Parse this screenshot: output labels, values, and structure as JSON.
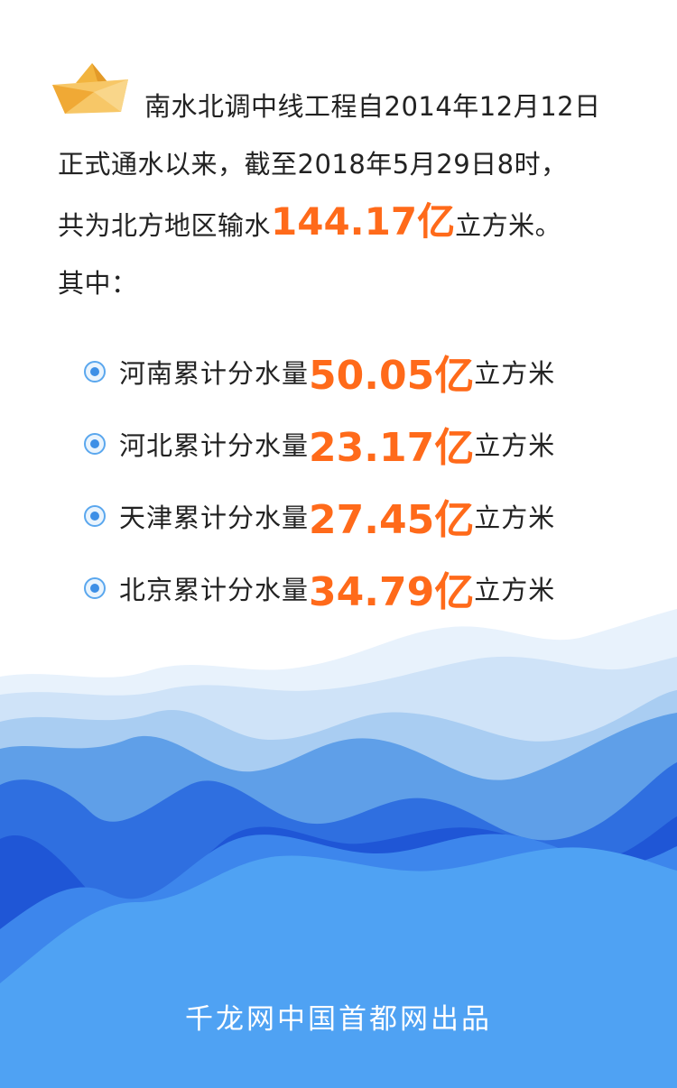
{
  "intro": {
    "line1": "南水北调中线工程自2014年12月12日",
    "line2": "正式通水以来，截至2018年5月29日8时，",
    "line3_pre": "共为北方地区输水",
    "line3_num": "144.17亿",
    "line3_post": "立方米。",
    "line4": "其中："
  },
  "items": [
    {
      "label": "河南累计分水量",
      "num": "50.05亿",
      "unit": "立方米"
    },
    {
      "label": "河北累计分水量",
      "num": "23.17亿",
      "unit": "立方米"
    },
    {
      "label": "天津累计分水量",
      "num": "27.45亿",
      "unit": "立方米"
    },
    {
      "label": "北京累计分水量",
      "num": "34.79亿",
      "unit": "立方米"
    }
  ],
  "footer": "千龙网中国首都网出品",
  "colors": {
    "highlight": "#ff6a1a",
    "text": "#222222",
    "water_deep": "#1f56d6",
    "water_light": "#4fa2f3",
    "bullet": "#5aa7ee"
  },
  "icons": {
    "boat": "paper-boat-icon",
    "bullet": "radio-dot-icon"
  }
}
